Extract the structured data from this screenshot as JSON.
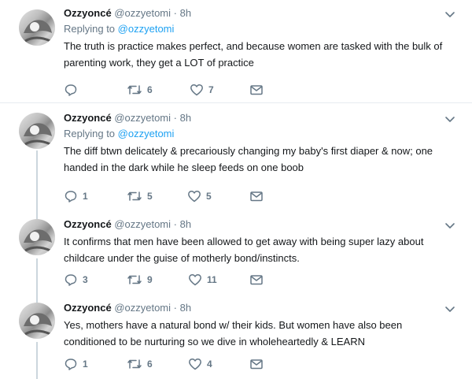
{
  "tweets": [
    {
      "name": "Ozzyoncé",
      "handle": "@ozzyetomi",
      "separator": "·",
      "time": "8h",
      "replying_prefix": "Replying to",
      "replying_to": "@ozzyetomi",
      "text": "The truth is practice makes perfect, and because women are tasked with the bulk of parenting work, they get a LOT of practice",
      "replies": "",
      "retweets": "6",
      "likes": "7"
    },
    {
      "name": "Ozzyoncé",
      "handle": "@ozzyetomi",
      "separator": "·",
      "time": "8h",
      "replying_prefix": "Replying to",
      "replying_to": "@ozzyetomi",
      "text": "The diff btwn delicately & precariously changing my baby's first diaper & now; one handed in the dark while he sleep feeds on one boob",
      "replies": "1",
      "retweets": "5",
      "likes": "5"
    },
    {
      "name": "Ozzyoncé",
      "handle": "@ozzyetomi",
      "separator": "·",
      "time": "8h",
      "text": "It confirms that men have been allowed to get away with being super lazy about childcare under the guise of motherly bond/instincts.",
      "replies": "3",
      "retweets": "9",
      "likes": "11"
    },
    {
      "name": "Ozzyoncé",
      "handle": "@ozzyetomi",
      "separator": "·",
      "time": "8h",
      "text": "Yes, mothers have a natural bond w/ their kids. But women have also been conditioned to be nurturing so we dive in wholeheartedly & LEARN",
      "replies": "1",
      "retweets": "6",
      "likes": "4"
    }
  ],
  "icons": {
    "reply": "reply-icon",
    "retweet": "retweet-icon",
    "like": "heart-icon",
    "dm": "envelope-icon",
    "more": "chevron-down-icon"
  },
  "colors": {
    "link": "#1da1f2",
    "secondary_text": "#657786",
    "thread_line": "#ccd6dd",
    "divider": "#e6ecf0"
  }
}
